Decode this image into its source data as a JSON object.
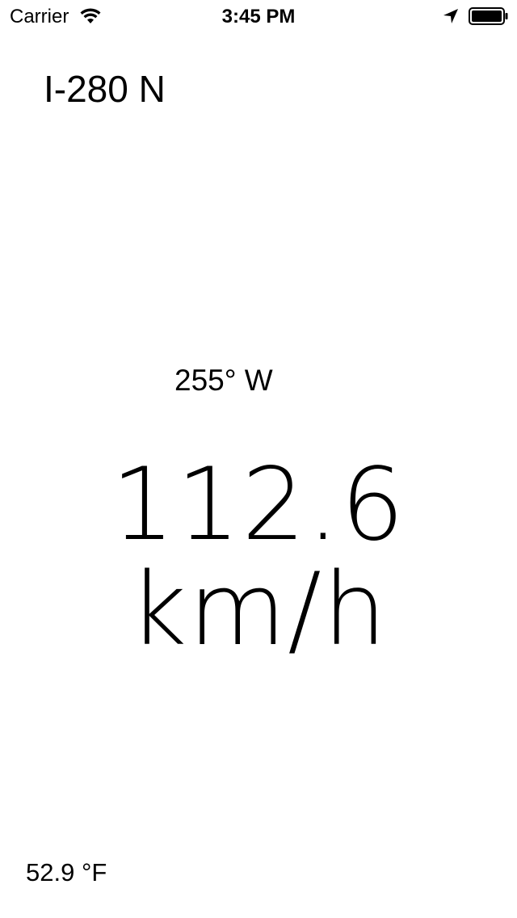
{
  "status_bar": {
    "carrier": "Carrier",
    "time": "3:45 PM",
    "icons": [
      "wifi-icon",
      "location-arrow-icon",
      "battery-icon"
    ]
  },
  "road": "I-280 N",
  "heading": "255° W",
  "speed": "112.6 km/h",
  "temperature": "52.9 °F",
  "colors": {
    "background": "#ffffff",
    "text": "#000000"
  }
}
